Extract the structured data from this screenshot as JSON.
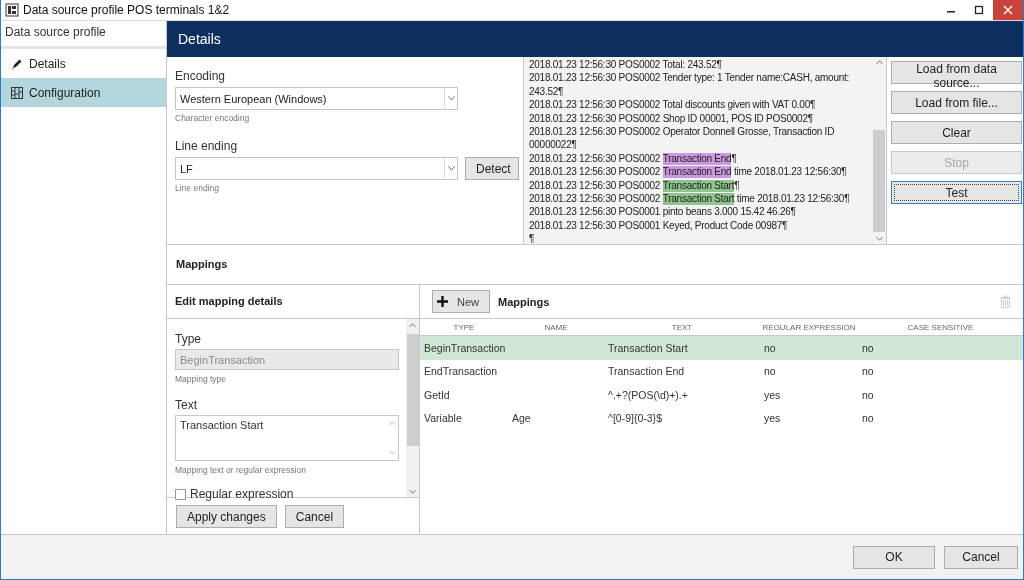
{
  "window": {
    "title": "Data source profile POS terminals 1&2"
  },
  "sidebar": {
    "title": "Data source profile",
    "items": [
      {
        "label": "Details",
        "selected": false
      },
      {
        "label": "Configuration",
        "selected": true
      }
    ]
  },
  "header": {
    "title": "Details"
  },
  "encoding": {
    "label": "Encoding",
    "value": "Western European (Windows)",
    "hint": "Character encoding"
  },
  "line_ending": {
    "label": "Line ending",
    "value": "LF",
    "hint": "Line ending",
    "button": "Detect"
  },
  "log": {
    "lines": [
      [
        {
          "text": "2018.01.23 12:56:30 POS0002 Total: 243.52¶"
        }
      ],
      [
        {
          "text": "2018.01.23 12:56:30 POS0002 Tender type: 1 Tender name:CASH, amount:"
        }
      ],
      [
        {
          "text": "243.52¶"
        }
      ],
      [
        {
          "text": "2018.01.23 12:56:30 POS0002 Total discounts given with VAT 0.00¶"
        }
      ],
      [
        {
          "text": "2018.01.23 12:56:30 POS0002 Shop ID 00001, POS ID POS0002¶"
        }
      ],
      [
        {
          "text": "2018.01.23 12:56:30 POS0002 Operator Donnell Grosse, Transaction ID"
        }
      ],
      [
        {
          "text": "00000022¶"
        }
      ],
      [
        {
          "text": "2018.01.23 12:56:30 POS0002 "
        },
        {
          "text": "Transaction End",
          "color": "#cc99e0"
        },
        {
          "text": "¶"
        }
      ],
      [
        {
          "text": "2018.01.23 12:56:30 POS0002 "
        },
        {
          "text": "Transaction End",
          "color": "#cc99e0"
        },
        {
          "text": " time 2018.01.23 12:56:30¶"
        }
      ],
      [
        {
          "text": "2018.01.23 12:56:30 POS0002 "
        },
        {
          "text": "Transaction Start",
          "color": "#8fc48f"
        },
        {
          "text": "¶"
        }
      ],
      [
        {
          "text": "2018.01.23 12:56:30 POS0002 "
        },
        {
          "text": "Transaction Start",
          "color": "#8fc48f"
        },
        {
          "text": " time 2018.01.23 12:56:30¶"
        }
      ],
      [
        {
          "text": "2018.01.23 12:56:30 POS0001 pinto beans 3.000 15.42 46.26¶"
        }
      ],
      [
        {
          "text": "2018.01.23 12:56:30 POS0001 Keyed, Product Code 00987¶"
        }
      ],
      [
        {
          "text": "¶"
        }
      ]
    ]
  },
  "log_buttons": [
    {
      "label": "Load from data source...",
      "disabled": false,
      "focused": false
    },
    {
      "label": "Load from file...",
      "disabled": false,
      "focused": false
    },
    {
      "label": "Clear",
      "disabled": false,
      "focused": false
    },
    {
      "label": "Stop",
      "disabled": true,
      "focused": false
    },
    {
      "label": "Test",
      "disabled": false,
      "focused": true
    }
  ],
  "mappings": {
    "title": "Mappings",
    "editor": {
      "title": "Edit mapping details",
      "type_label": "Type",
      "type_value": "BeginTransaction",
      "type_hint": "Mapping type",
      "text_label": "Text",
      "text_value": "Transaction Start",
      "text_hint": "Mapping text or regular expression",
      "regex": {
        "label": "Regular expression",
        "checked": false
      },
      "buttons": [
        "Apply changes",
        "Cancel"
      ]
    },
    "list": {
      "new_button": "New",
      "title": "Mappings",
      "columns": [
        "TYPE",
        "NAME",
        "TEXT",
        "REGULAR EXPRESSION",
        "CASE SENSITIVE"
      ],
      "rows": [
        {
          "cells": [
            "BeginTransaction",
            "",
            "Transaction Start",
            "no",
            "no"
          ],
          "selected": true
        },
        {
          "cells": [
            "EndTransaction",
            "",
            "Transaction End",
            "no",
            "no"
          ],
          "selected": false
        },
        {
          "cells": [
            "GetId",
            "",
            "^.+?(POS(\\d)+).+",
            "yes",
            "no"
          ],
          "selected": false
        },
        {
          "cells": [
            "Variable",
            "Age",
            "^[0-9]{0-3}$",
            "yes",
            "no"
          ],
          "selected": false
        }
      ]
    }
  },
  "footer": {
    "buttons": [
      "OK",
      "Cancel"
    ]
  }
}
